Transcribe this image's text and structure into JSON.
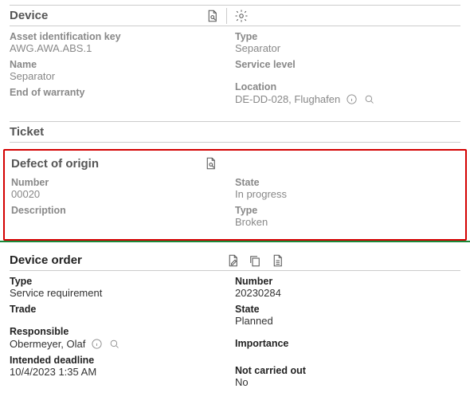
{
  "device": {
    "title": "Device",
    "asset_key_label": "Asset identification key",
    "asset_key_value": "AWG.AWA.ABS.1",
    "name_label": "Name",
    "name_value": "Separator",
    "eow_label": "End of warranty",
    "type_label": "Type",
    "type_value": "Separator",
    "service_level_label": "Service level",
    "location_label": "Location",
    "location_value": "DE-DD-028, Flughafen"
  },
  "ticket": {
    "title": "Ticket"
  },
  "defect": {
    "title": "Defect of origin",
    "number_label": "Number",
    "number_value": "00020",
    "description_label": "Description",
    "state_label": "State",
    "state_value": "In progress",
    "type_label": "Type",
    "type_value": "Broken"
  },
  "order": {
    "title": "Device order",
    "type_label": "Type",
    "type_value": "Service requirement",
    "trade_label": "Trade",
    "responsible_label": "Responsible",
    "responsible_value": "Obermeyer, Olaf",
    "deadline_label": "Intended deadline",
    "deadline_value": "10/4/2023 1:35 AM",
    "number_label": "Number",
    "number_value": "20230284",
    "state_label": "State",
    "state_value": "Planned",
    "importance_label": "Importance",
    "nco_label": "Not carried out",
    "nco_value": "No"
  }
}
